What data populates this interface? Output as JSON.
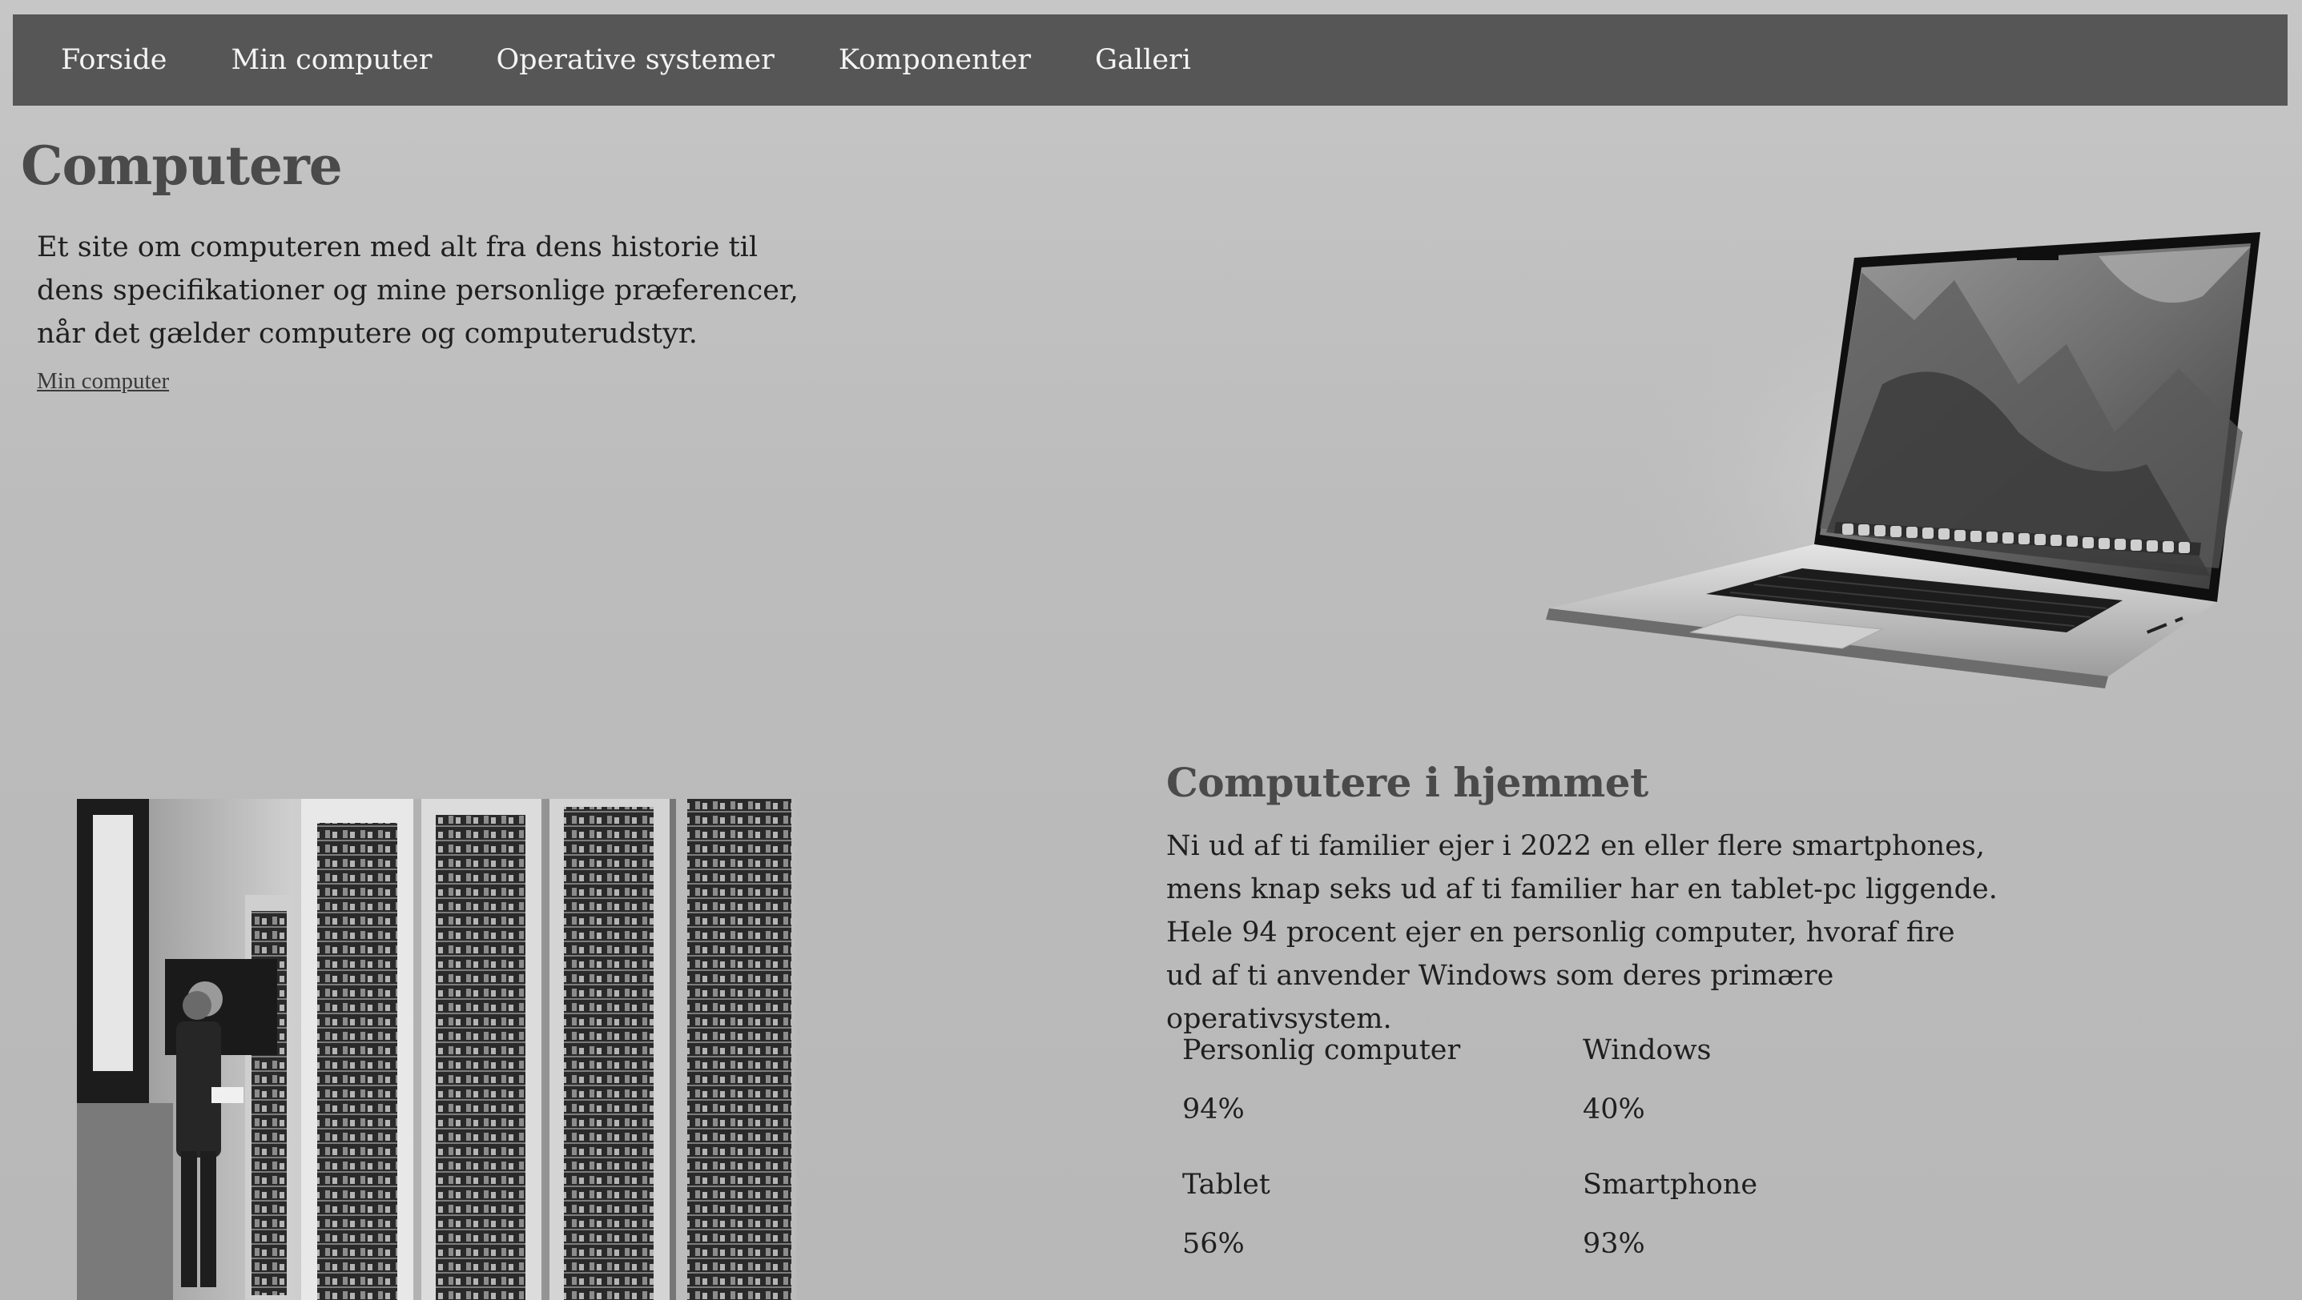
{
  "nav": {
    "items": [
      {
        "label": "Forside"
      },
      {
        "label": "Min computer"
      },
      {
        "label": "Operative systemer"
      },
      {
        "label": "Komponenter"
      },
      {
        "label": "Galleri"
      }
    ]
  },
  "hero": {
    "title": "Computere",
    "intro": "Et site om computeren med alt fra dens historie til dens specifikationer og mine personlige præferencer, når det gælder computere og computerudstyr.",
    "link_label": "Min computer"
  },
  "home_section": {
    "title": "Computere i hjemmet",
    "text": "Ni ud af ti familier ejer i 2022 en eller flere smartphones, mens knap seks ud af ti familier har en tablet-pc liggende. Hele 94 procent ejer en personlig computer, hvoraf fire ud af ti anvender Windows som deres primære operativsystem.",
    "stats": [
      {
        "label": "Personlig computer",
        "value": "94%"
      },
      {
        "label": "Windows",
        "value": "40%"
      },
      {
        "label": "Tablet",
        "value": "56%"
      },
      {
        "label": "Smartphone",
        "value": "93%"
      }
    ]
  },
  "images": {
    "laptop": "laptop-photo",
    "historic": "mainframe-photo"
  }
}
